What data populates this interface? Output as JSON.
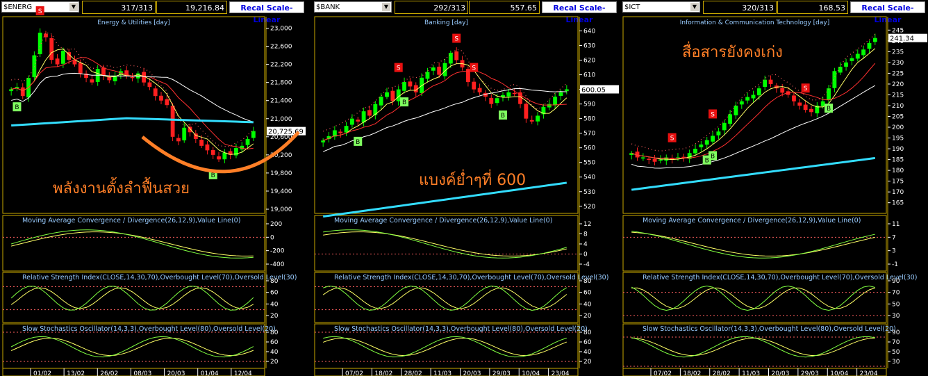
{
  "panels": [
    {
      "symbol": "$ENERG",
      "count": "317/313",
      "last": "19,216.84",
      "recal": "Recal Scale-Linear",
      "title": "Energy & Utilities [day]",
      "price_tag": "20,725.69",
      "price_value": 20725.69,
      "annotation": "พลังงานตั้งลำฟื้นสวย",
      "y_ticks": [
        "23,000",
        "22,600",
        "22,200",
        "21,800",
        "21,400",
        "21,000",
        "20,600",
        "20,200",
        "19,800",
        "19,400",
        "19,000"
      ],
      "macd_ticks": [
        "200",
        "0",
        "-200",
        "-400"
      ],
      "rsi_ticks": [
        "80",
        "60",
        "40",
        "20"
      ],
      "stoch_ticks": [
        "80",
        "60",
        "40",
        "20"
      ],
      "x_labels": [
        "01/02",
        "13/02",
        "26/02",
        "08/03",
        "20/03",
        "01/04",
        "12/04"
      ]
    },
    {
      "symbol": "$BANK",
      "count": "292/313",
      "last": "557.65",
      "recal": "Recal Scale-Linear",
      "title": "Banking [day]",
      "price_tag": "600.05",
      "price_value": 600.05,
      "annotation": "แบงค์ย่ำๆที่ 600",
      "y_ticks": [
        "640",
        "630",
        "620",
        "610",
        "600",
        "590",
        "580",
        "570",
        "560",
        "550",
        "540",
        "530",
        "520"
      ],
      "macd_ticks": [
        "12",
        "8",
        "4",
        "0",
        "-4"
      ],
      "rsi_ticks": [
        "80",
        "60",
        "40",
        "20"
      ],
      "stoch_ticks": [
        "80",
        "60",
        "40",
        "20"
      ],
      "x_labels": [
        "07/02",
        "18/02",
        "28/02",
        "11/03",
        "20/03",
        "29/03",
        "10/04",
        "23/04"
      ]
    },
    {
      "symbol": "$ICT",
      "count": "320/313",
      "last": "168.53",
      "recal": "Recal Scale-Linear",
      "title": "Information & Communication Technology [day]",
      "price_tag": "241.34",
      "price_value": 241.34,
      "annotation": "สื่อสารยังคงเก่ง",
      "y_ticks": [
        "245",
        "240",
        "235",
        "230",
        "225",
        "220",
        "215",
        "210",
        "205",
        "200",
        "195",
        "190",
        "185",
        "180",
        "175",
        "170",
        "165"
      ],
      "macd_ticks": [
        "11",
        "7",
        "3",
        "-1"
      ],
      "rsi_ticks": [
        "90",
        "70",
        "50",
        "30"
      ],
      "stoch_ticks": [
        "90",
        "70",
        "50",
        "30"
      ],
      "x_labels": [
        "07/02",
        "18/02",
        "28/02",
        "11/03",
        "20/03",
        "29/03",
        "10/04",
        "23/04"
      ]
    }
  ],
  "indicators": {
    "macd": "Moving Average Convergence / Divergence(26,12,9),Value Line(0)",
    "rsi": "Relative Strength Index(CLOSE,14,30,70),Overbought Level(70),Oversold Level(30)",
    "stoch": "Slow Stochastics Oscillator(14,3,3),Overbought Level(80),Oversold Level(20)"
  },
  "signal_labels": {
    "sell": "S",
    "buy": "B"
  },
  "colors": {
    "up": "#00ff00",
    "down": "#ff2020",
    "ma_long": "#33ddff",
    "annotation": "#ff7f27",
    "gold": "#c8a800"
  },
  "chart_data": [
    {
      "type": "candlestick",
      "title": "Energy & Utilities [day]",
      "ylim": [
        19000,
        23100
      ],
      "closes": [
        21650,
        21700,
        21500,
        21900,
        22400,
        22900,
        22800,
        22300,
        22200,
        22500,
        22300,
        22200,
        22000,
        21900,
        21800,
        22100,
        21950,
        21850,
        21950,
        22050,
        21950,
        21900,
        22000,
        21800,
        21700,
        21500,
        21400,
        21300,
        20600,
        20500,
        20800,
        20700,
        20550,
        20400,
        20300,
        20200,
        20100,
        20250,
        20200,
        20350,
        20400,
        20550,
        20725.69
      ],
      "sell_signals": [
        5
      ],
      "buy_signals": [
        1,
        35
      ]
    },
    {
      "type": "candlestick",
      "title": "Banking [day]",
      "ylim": [
        518,
        645
      ],
      "closes": [
        565,
        568,
        572,
        570,
        575,
        580,
        578,
        585,
        582,
        590,
        595,
        598,
        592,
        600,
        605,
        602,
        598,
        608,
        612,
        615,
        610,
        618,
        625,
        620,
        615,
        605,
        600,
        598,
        595,
        590,
        594,
        596,
        598,
        597,
        590,
        580,
        578,
        582,
        588,
        590,
        595,
        598,
        600.05
      ],
      "sell_signals": [
        13,
        23,
        26
      ],
      "buy_signals": [
        6,
        14,
        31
      ]
    },
    {
      "type": "candlestick",
      "title": "Information & Communication Technology [day]",
      "ylim": [
        162,
        248
      ],
      "closes": [
        188,
        186,
        186,
        185,
        184,
        185,
        186,
        185,
        186,
        186,
        188,
        190,
        192,
        194,
        196,
        198,
        202,
        206,
        210,
        212,
        214,
        215,
        218,
        222,
        220,
        218,
        216,
        215,
        212,
        210,
        208,
        207,
        210,
        212,
        218,
        226,
        228,
        230,
        232,
        234,
        236,
        239,
        241.34
      ],
      "sell_signals": [
        7,
        14,
        30
      ],
      "buy_signals": [
        13,
        14,
        34
      ]
    }
  ]
}
